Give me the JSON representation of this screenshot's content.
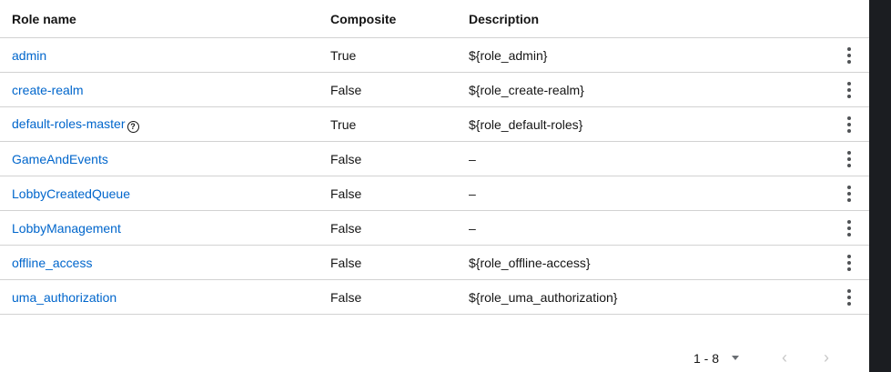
{
  "table": {
    "headers": {
      "name": "Role name",
      "composite": "Composite",
      "description": "Description"
    },
    "rows": [
      {
        "name": "admin",
        "composite": "True",
        "description": "${role_admin}"
      },
      {
        "name": "create-realm",
        "composite": "False",
        "description": "${role_create-realm}"
      },
      {
        "name": "default-roles-master",
        "composite": "True",
        "description": "${role_default-roles}",
        "help_icon": "?"
      },
      {
        "name": "GameAndEvents",
        "composite": "False",
        "description": "–"
      },
      {
        "name": "LobbyCreatedQueue",
        "composite": "False",
        "description": "–"
      },
      {
        "name": "LobbyManagement",
        "composite": "False",
        "description": "–"
      },
      {
        "name": "offline_access",
        "composite": "False",
        "description": "${role_offline-access}"
      },
      {
        "name": "uma_authorization",
        "composite": "False",
        "description": "${role_uma_authorization}"
      }
    ]
  },
  "pagination": {
    "range": "1 - 8",
    "prev_icon": "‹",
    "next_icon": "›"
  },
  "colors": {
    "link": "#0066cc",
    "border": "#d2d2d2",
    "scrollbar": "#1b1d21"
  }
}
